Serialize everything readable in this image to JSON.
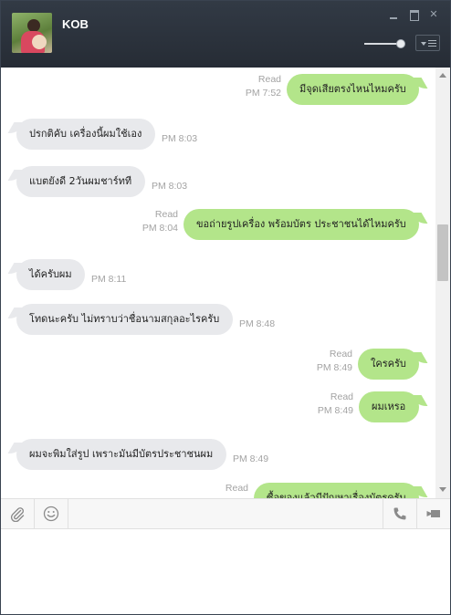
{
  "header": {
    "contact_name": "KOB",
    "volume_level": 0.9
  },
  "messages": [
    {
      "dir": "out",
      "text": "มีจุดเสียตรงไหนไหมครับ",
      "read": "Read",
      "time": "PM 7:52"
    },
    {
      "dir": "in",
      "text": "ปรกติคับ เครื่องนี้ผมใช้เอง",
      "time": "PM 8:03"
    },
    {
      "dir": "in",
      "text": "แบตยังดี 2วันผมชาร์ทที",
      "time": "PM 8:03"
    },
    {
      "dir": "out",
      "text": "ขอถ่ายรูปเครื่อง พร้อมบัตร ประชาชนได้ไหมครับ",
      "read": "Read",
      "time": "PM 8:04"
    },
    {
      "dir": "in",
      "text": "ได้ครับผม",
      "time": "PM 8:11"
    },
    {
      "dir": "in",
      "text": "โทดนะครับ ไม่ทราบว่าชื่อนามสกุลอะไรครับ",
      "time": "PM 8:48"
    },
    {
      "dir": "out",
      "text": "ใครครับ",
      "read": "Read",
      "time": "PM 8:49"
    },
    {
      "dir": "out",
      "text": "ผมเหรอ",
      "read": "Read",
      "time": "PM 8:49"
    },
    {
      "dir": "in",
      "text": "ผมจะพิมใส่รูป เพราะมันมีบัตรประชาชนผม",
      "time": "PM 8:49"
    },
    {
      "dir": "out",
      "text": "ซื้อของแล้วมีปัญหาเรื่องบัตรครับ",
      "read": "Read",
      "time": ""
    }
  ],
  "colors": {
    "header_bg": "#2b323c",
    "outgoing_bubble": "#b3e58a",
    "incoming_bubble": "#e8e9ec",
    "meta_text": "#a3a3a3"
  },
  "icons": {
    "attach": "paperclip-icon",
    "emoji": "smiley-icon",
    "call": "phone-icon",
    "video": "video-camera-icon",
    "menu": "menu-icon"
  },
  "composer": {
    "value": ""
  }
}
